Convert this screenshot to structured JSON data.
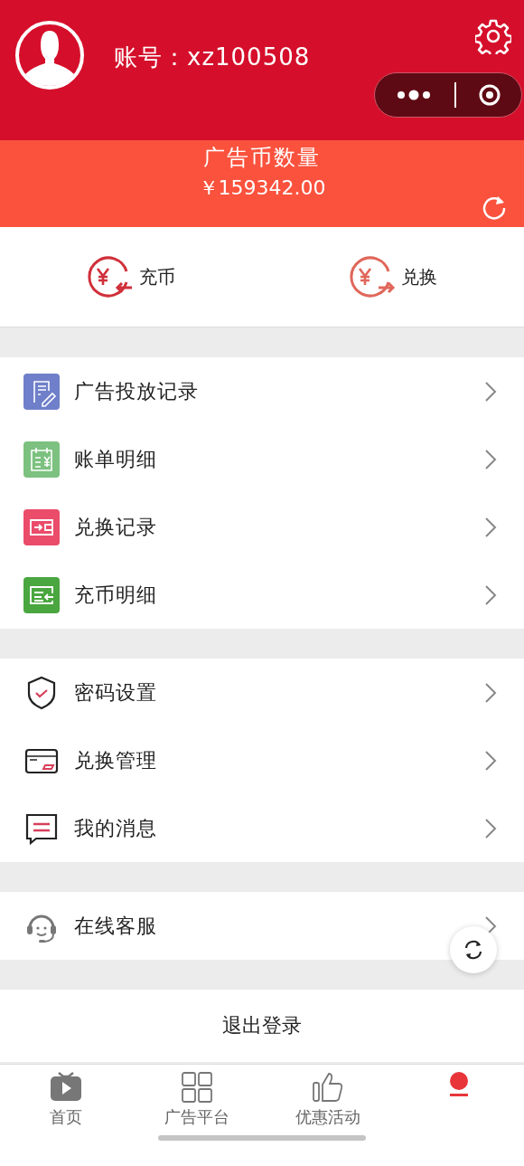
{
  "header": {
    "account": "账号：xz100508"
  },
  "balance": {
    "title": "广告币数量",
    "amount": "￥159342.00"
  },
  "actions": [
    {
      "kind": "in",
      "label": "充币",
      "color": "#d0303a"
    },
    {
      "kind": "out",
      "label": "兑换",
      "color": "#e0675a"
    }
  ],
  "menu_groups": [
    {
      "items": [
        {
          "kind": "edit",
          "label": "广告投放记录",
          "color": "#6f7fc9"
        },
        {
          "kind": "bill",
          "label": "账单明细",
          "color": "#7cc17f"
        },
        {
          "kind": "wallet",
          "label": "兑换记录",
          "color": "#ea4c6a"
        },
        {
          "kind": "card",
          "label": "充币明细",
          "color": "#4aa63f"
        }
      ]
    },
    {
      "items": [
        {
          "kind": "shield",
          "label": "密码设置"
        },
        {
          "kind": "bankcard",
          "label": "兑换管理"
        },
        {
          "kind": "message",
          "label": "我的消息"
        }
      ]
    },
    {
      "items": [
        {
          "kind": "headset",
          "label": "在线客服"
        }
      ]
    }
  ],
  "logout": {
    "label": "退出登录"
  },
  "tab_bar": [
    {
      "kind": "tv",
      "label": "首页",
      "selected": false
    },
    {
      "kind": "grid",
      "label": "广告平台",
      "selected": false
    },
    {
      "kind": "thumb",
      "label": "优惠活动",
      "selected": false
    },
    {
      "kind": "person",
      "selected": true
    }
  ]
}
